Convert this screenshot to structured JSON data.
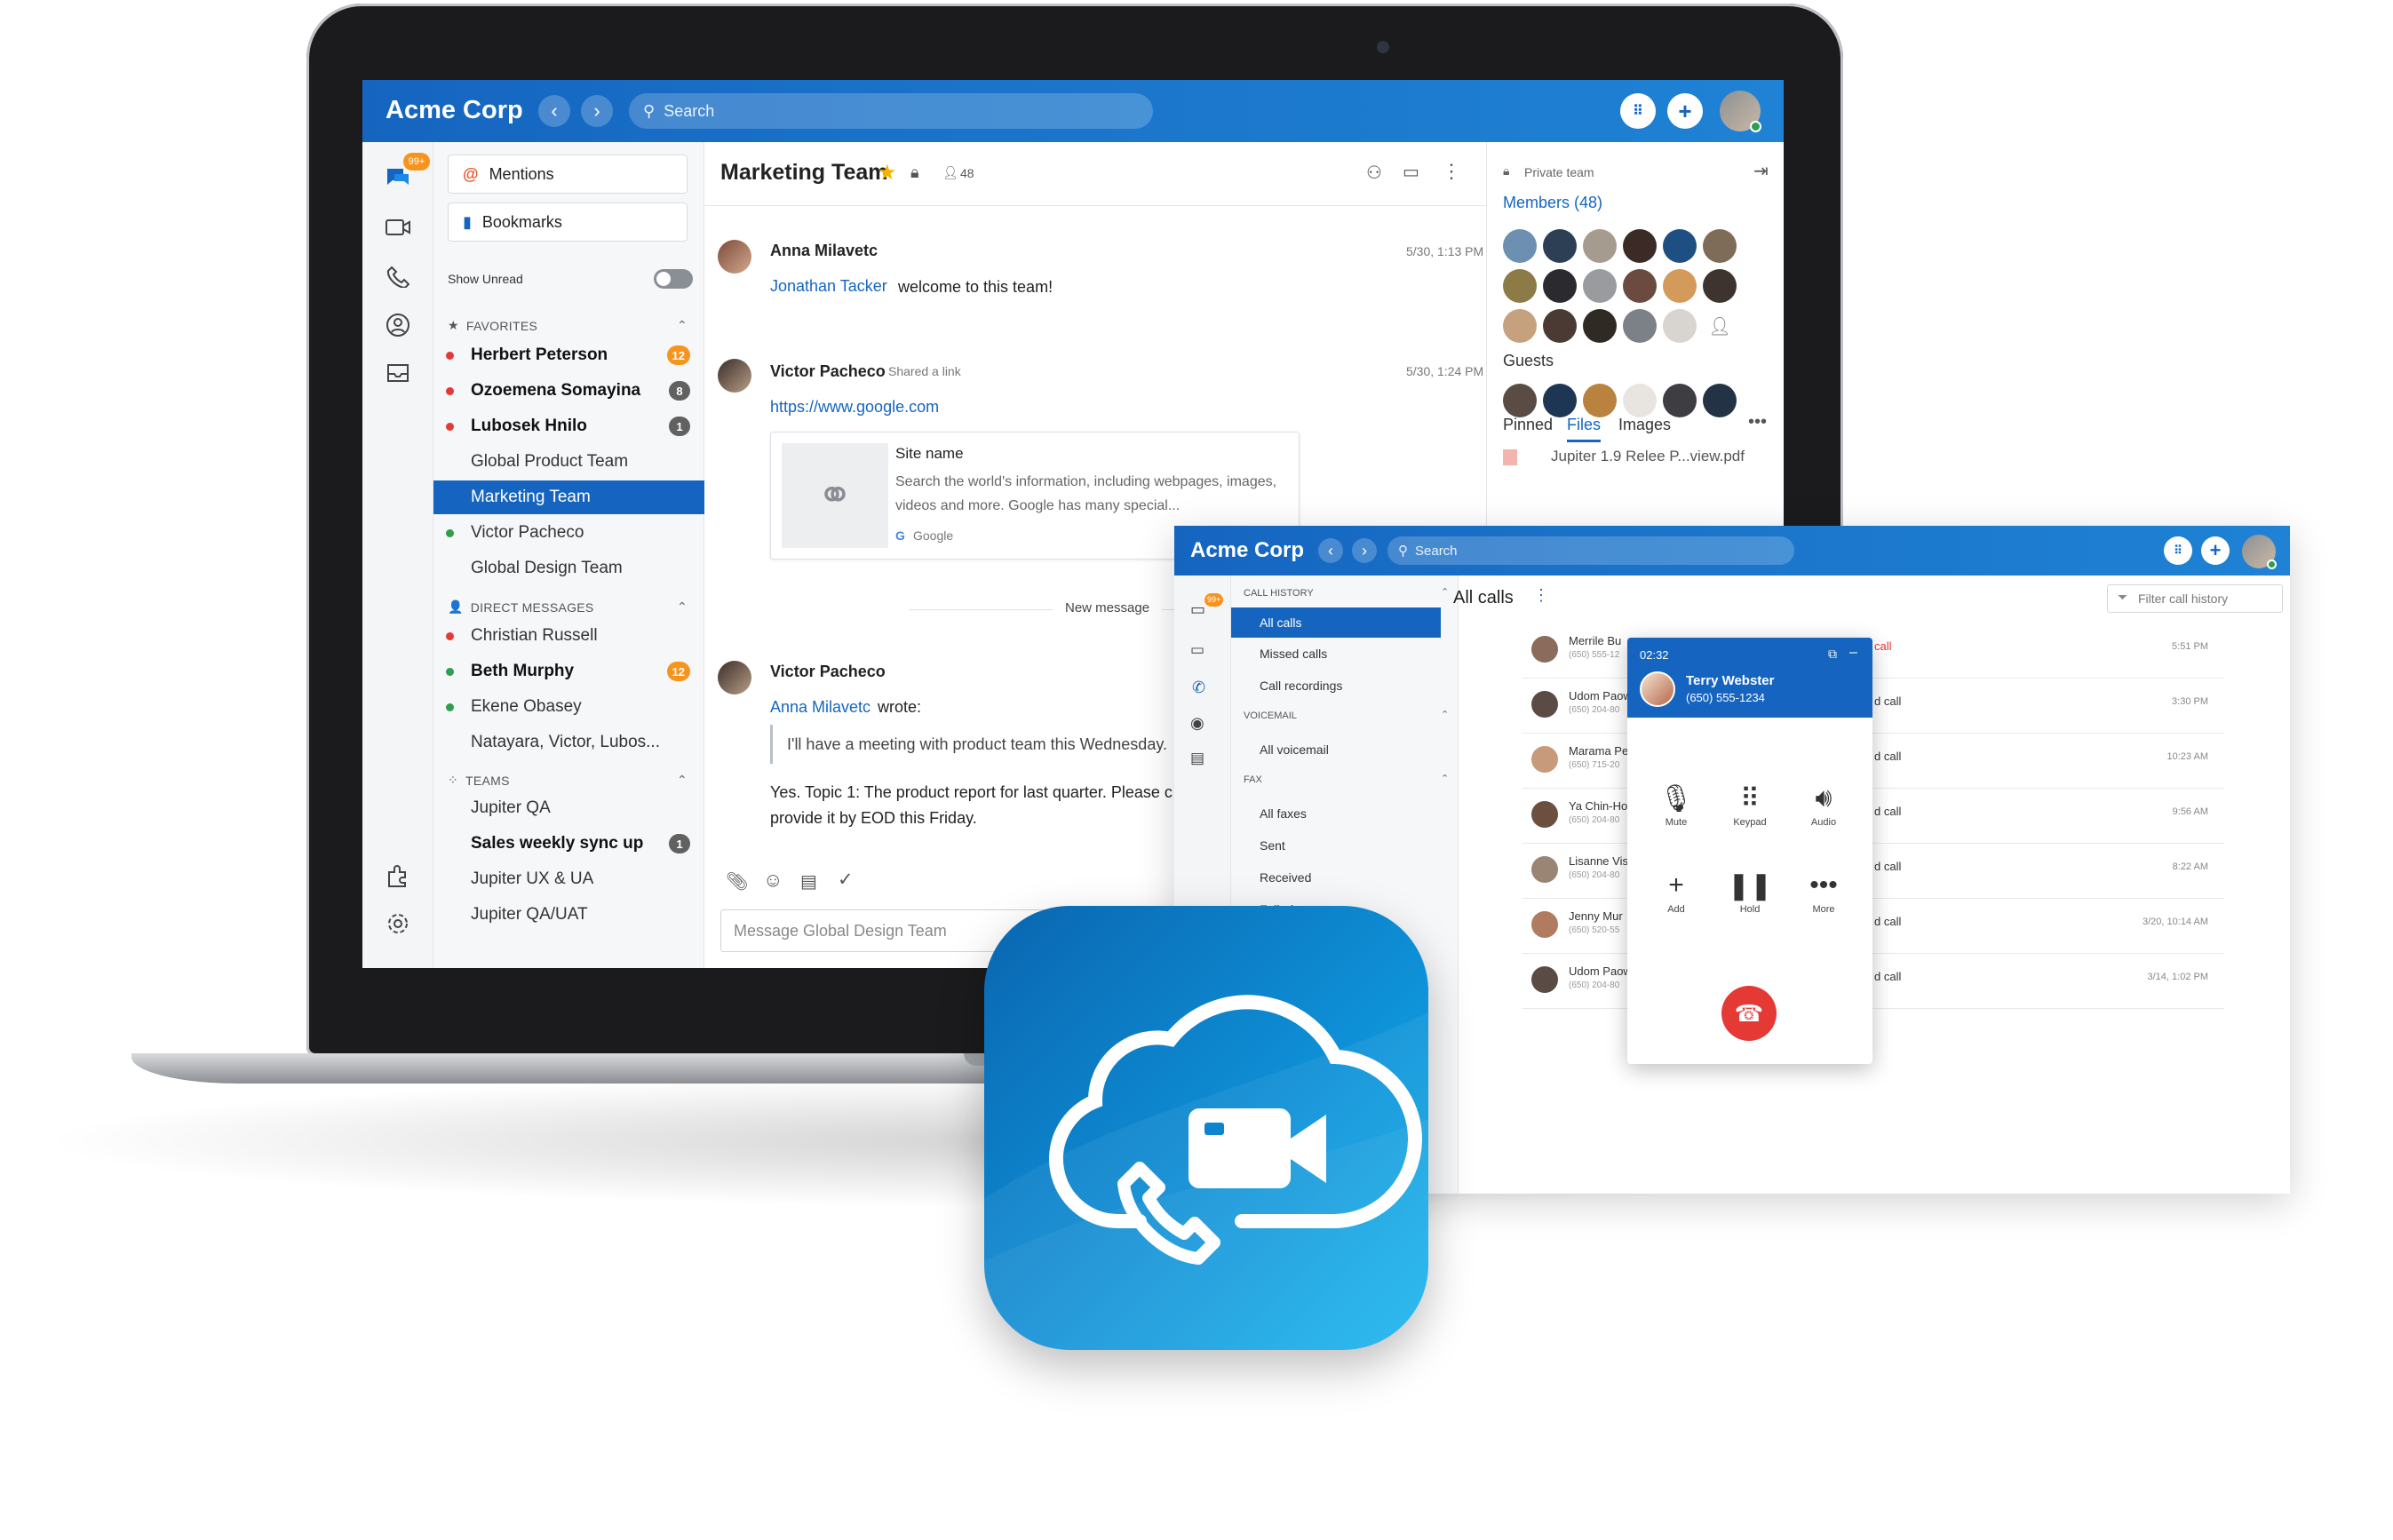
{
  "laptop": {
    "brand": "Acme Corp",
    "search_placeholder": "Search",
    "rail_badge": "99+",
    "sidebar": {
      "mentions": "Mentions",
      "bookmarks": "Bookmarks",
      "show_unread": "Show Unread",
      "favorites_header": "FAVORITES",
      "favorites": [
        {
          "label": "Herbert Peterson",
          "count": "12"
        },
        {
          "label": "Ozoemena Somayina",
          "count": "8"
        },
        {
          "label": "Lubosek Hnilo",
          "count": "1"
        },
        {
          "label": "Global Product Team"
        },
        {
          "label": "Marketing Team"
        },
        {
          "label": "Victor Pacheco"
        },
        {
          "label": "Global Design Team"
        }
      ],
      "dm_header": "DIRECT MESSAGES",
      "dms": [
        {
          "label": "Christian Russell"
        },
        {
          "label": "Beth Murphy",
          "count": "12"
        },
        {
          "label": "Ekene Obasey"
        },
        {
          "label": "Natayara, Victor, Lubos..."
        }
      ],
      "teams_header": "TEAMS",
      "teams": [
        {
          "label": "Jupiter QA"
        },
        {
          "label": "Sales weekly sync up",
          "count": "1"
        },
        {
          "label": "Jupiter UX & UA"
        },
        {
          "label": "Jupiter QA/UAT"
        }
      ]
    },
    "conversation": {
      "title": "Marketing Team",
      "member_count": "48",
      "messages": [
        {
          "author": "Anna Milavetc",
          "time": "5/30, 1:13 PM",
          "mention": "Jonathan Tacker",
          "text": "welcome to this team!"
        },
        {
          "author": "Victor Pacheco",
          "sub": "Shared a link",
          "time": "5/30, 1:24 PM",
          "url": "https://www.google.com",
          "card_title": "Site name",
          "card_desc": "Search the world's information, including webpages, images, videos and more. Google has many special...",
          "card_source": "Google"
        },
        {
          "author": "Victor Pacheco",
          "quote_author": "Anna Milavetc",
          "wrote": "wrote:",
          "quote": "I'll have a meeting with product team this Wednesday.",
          "text": "Yes. Topic 1: The product report for last quarter. Please c provide it by EOD this Friday."
        }
      ],
      "new_message": "New message",
      "composer_placeholder": "Message Global Design Team"
    },
    "right_panel": {
      "private": "Private team",
      "members": "Members (48)",
      "guests": "Guests",
      "tabs": [
        "Pinned",
        "Files",
        "Images"
      ],
      "active_tab": "Files",
      "file": "Jupiter 1.9 Relee P...view.pdf"
    }
  },
  "phone_window": {
    "brand": "Acme Corp",
    "search_placeholder": "Search",
    "rail_badge": "99+",
    "nav": {
      "call_history": "CALL HISTORY",
      "call_items": [
        "All calls",
        "Missed calls",
        "Call recordings"
      ],
      "voicemail": "VOICEMAIL",
      "voicemail_items": [
        "All voicemail"
      ],
      "fax": "FAX",
      "fax_items": [
        "All faxes",
        "Sent",
        "Received",
        "Failed"
      ]
    },
    "title": "All calls",
    "filter_placeholder": "Filter call history",
    "calls": [
      {
        "name": "Merrile Bu",
        "number": "(650) 555-12",
        "type": "call",
        "time": "5:51 PM",
        "missed": true
      },
      {
        "name": "Udom Paow",
        "number": "(650) 204-80",
        "type": "d call",
        "time": "3:30 PM"
      },
      {
        "name": "Marama Pe",
        "number": "(650) 715-20",
        "type": "d call",
        "time": "10:23 AM"
      },
      {
        "name": "Ya Chin-Ho",
        "number": "(650) 204-80",
        "type": "d call",
        "time": "9:56 AM"
      },
      {
        "name": "Lisanne Vis",
        "number": "(650) 204-80",
        "type": "d call",
        "time": "8:22 AM"
      },
      {
        "name": "Jenny Mur",
        "number": "(650) 520-55",
        "type": "d call",
        "time": "3/20, 10:14 AM"
      },
      {
        "name": "Udom Paow",
        "number": "(650) 204-80",
        "type": "d call",
        "time": "3/14, 1:02 PM"
      }
    ],
    "dialer": {
      "timer": "02:32",
      "caller": "Terry Webster",
      "number": "(650) 555-1234",
      "buttons": [
        "Mute",
        "Keypad",
        "Audio",
        "Add",
        "Hold",
        "More"
      ]
    }
  },
  "colors": {
    "brand_blue": "#1565c0",
    "badge_orange": "#f7941d",
    "presence_red": "#e53935",
    "presence_green": "#2e9e4f",
    "hangup": "#e53935"
  }
}
